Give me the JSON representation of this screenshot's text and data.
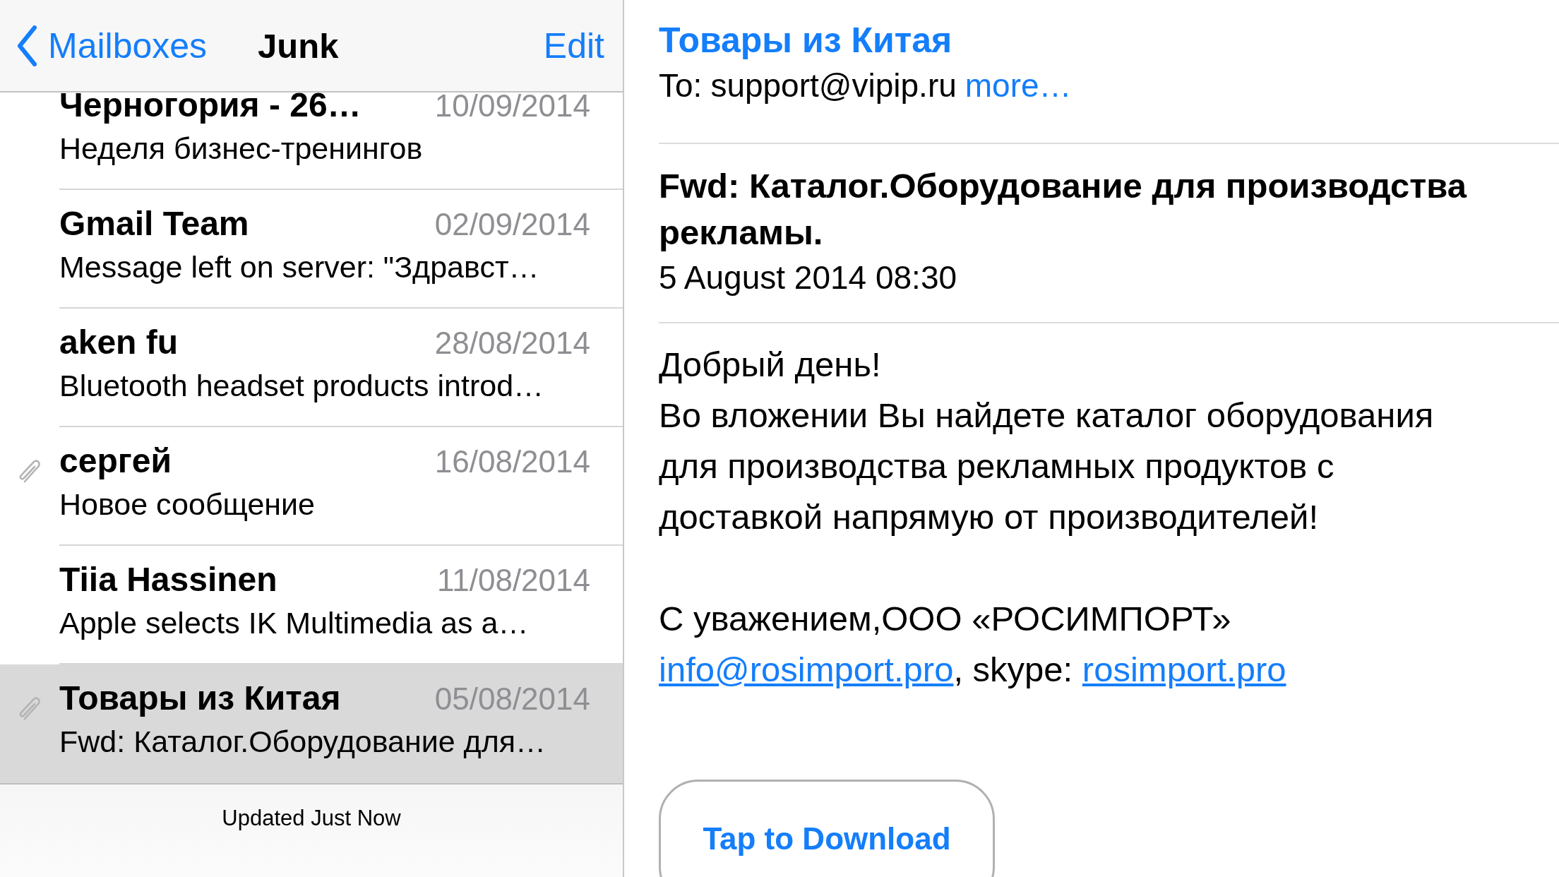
{
  "nav": {
    "back_label": "Mailboxes",
    "title": "Junk",
    "edit_label": "Edit"
  },
  "messages": [
    {
      "sender": "Черногория - 26…",
      "date": "10/09/2014",
      "preview": "Неделя бизнес-тренингов",
      "attachment": false,
      "selected": false
    },
    {
      "sender": "Gmail Team",
      "date": "02/09/2014",
      "preview": "Message left on server: \"Здравст…",
      "attachment": false,
      "selected": false
    },
    {
      "sender": "aken fu",
      "date": "28/08/2014",
      "preview": "Bluetooth headset products introd…",
      "attachment": false,
      "selected": false
    },
    {
      "sender": "сергей",
      "date": "16/08/2014",
      "preview": "Новое сообщение",
      "attachment": true,
      "selected": false
    },
    {
      "sender": "Tiia Hassinen",
      "date": "11/08/2014",
      "preview": "Apple selects IK Multimedia as a…",
      "attachment": false,
      "selected": false
    },
    {
      "sender": "Товары из Китая",
      "date": "05/08/2014",
      "preview": "Fwd: Каталог.Оборудование для…",
      "attachment": true,
      "selected": true
    }
  ],
  "status": "Updated Just Now",
  "detail": {
    "from": "Товары из Китая",
    "to_label": "To:",
    "to_address": "support@vipip.ru",
    "more": "more…",
    "subject": "Fwd: Каталог.Оборудование для производства рекламы.",
    "date": "5 August 2014 08:30",
    "body": [
      {
        "kind": "paragraph",
        "text": "Добрый день!"
      },
      {
        "kind": "paragraph",
        "text": "Во вложении Вы найдете каталог оборудования для производства рекламных продуктов с доставкой напрямую от производителей!"
      },
      {
        "kind": "signature",
        "text": "С уважением,ООО «РОСИМПОРТ»"
      }
    ],
    "contact_line": [
      {
        "kind": "link",
        "text": "info@rosimport.pro"
      },
      {
        "kind": "text",
        "text": ", skype: "
      },
      {
        "kind": "link",
        "text": "rosimport.pro"
      }
    ],
    "download_button": "Tap to Download"
  }
}
